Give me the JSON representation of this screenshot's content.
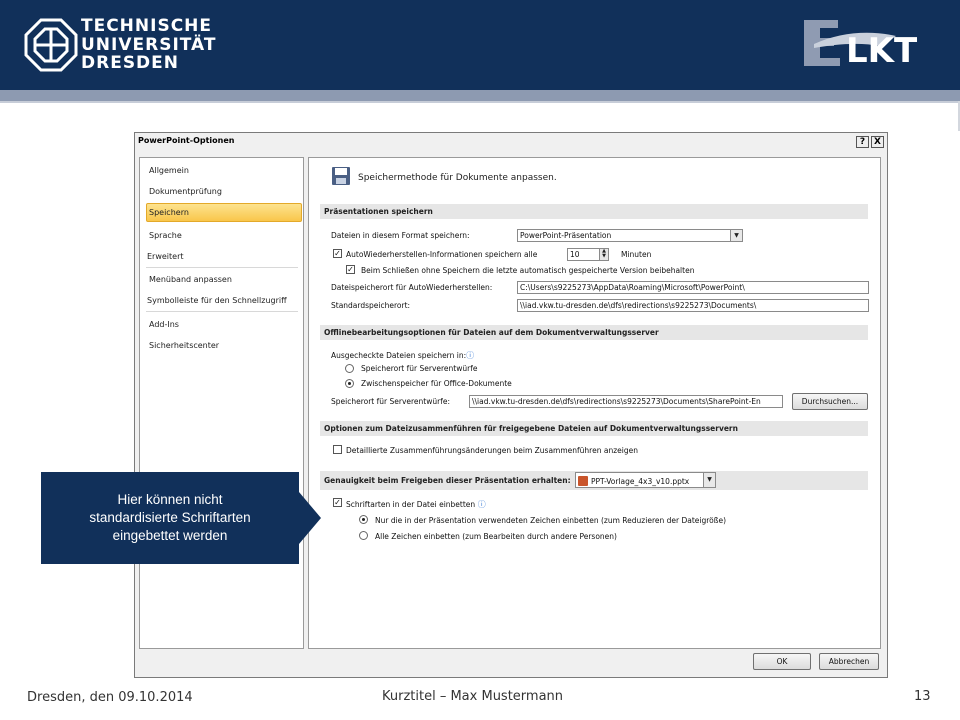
{
  "header": {
    "tud_line1": "TECHNISCHE",
    "tud_line2": "UNIVERSITÄT",
    "tud_line3": "DRESDEN",
    "lkt_logo": "LKT",
    "bg_color": "#11305a"
  },
  "dialog": {
    "title": "PowerPoint-Optionen",
    "help_button": "?",
    "close_button": "X",
    "nav": [
      "Allgemein",
      "Dokumentprüfung",
      "Speichern",
      "Sprache",
      "Erweitert",
      "Menüband anpassen",
      "Symbolleiste für den Schnellzugriff",
      "Add-Ins",
      "Sicherheitscenter"
    ],
    "selected_nav": "Speichern",
    "heading": "Speichermethode für Dokumente anpassen.",
    "sec1": {
      "title": "Präsentationen speichern",
      "format_label": "Dateien in diesem Format speichern:",
      "format_value": "PowerPoint-Präsentation",
      "autorecover_label": "AutoWiederherstellen-Informationen speichern alle",
      "autorecover_value": "10",
      "autorecover_unit": "Minuten",
      "keep_label": "Beim Schließen ohne Speichern die letzte automatisch gespeicherte Version beibehalten",
      "autorecover_path_label": "Dateispeicherort für AutoWiederherstellen:",
      "autorecover_path": "C:\\Users\\s9225273\\AppData\\Roaming\\Microsoft\\PowerPoint\\",
      "default_path_label": "Standardspeicherort:",
      "default_path": "\\\\iad.vkw.tu-dresden.de\\dfs\\redirections\\s9225273\\Documents\\"
    },
    "sec2": {
      "title": "Offlinebearbeitungsoptionen für Dateien auf dem Dokumentverwaltungsserver",
      "checked_out_label": "Ausgecheckte Dateien speichern in:",
      "radio1": "Speicherort für Serverentwürfe",
      "radio2": "Zwischenspeicher für Office-Dokumente",
      "drafts_label": "Speicherort für Serverentwürfe:",
      "drafts_path": "\\\\iad.vkw.tu-dresden.de\\dfs\\redirections\\s9225273\\Documents\\SharePoint-En",
      "browse_button": "Durchsuchen..."
    },
    "sec3": {
      "title": "Optionen zum Dateizusammenführen für freigegebene Dateien auf Dokumentverwaltungsservern",
      "merge_label": "Detaillierte Zusammenführungsänderungen beim Zusammenführen anzeigen"
    },
    "sec4": {
      "title": "Genauigkeit beim Freigeben dieser Präsentation erhalten:",
      "file_value": "PPT-Vorlage_4x3_v10.pptx",
      "embed_label": "Schriftarten in der Datei einbetten",
      "embed_radio1": "Nur die in der Präsentation verwendeten Zeichen einbetten (zum Reduzieren der Dateigröße)",
      "embed_radio2": "Alle Zeichen einbetten (zum Bearbeiten durch andere Personen)"
    },
    "ok_button": "OK",
    "cancel_button": "Abbrechen"
  },
  "callout": {
    "line1": "Hier können nicht",
    "line2": "standardisierte Schriftarten",
    "line3": "eingebettet werden"
  },
  "footer": {
    "date": "Dresden, den 09.10.2014",
    "center": "Kurztitel – Max Mustermann",
    "page": "13"
  }
}
